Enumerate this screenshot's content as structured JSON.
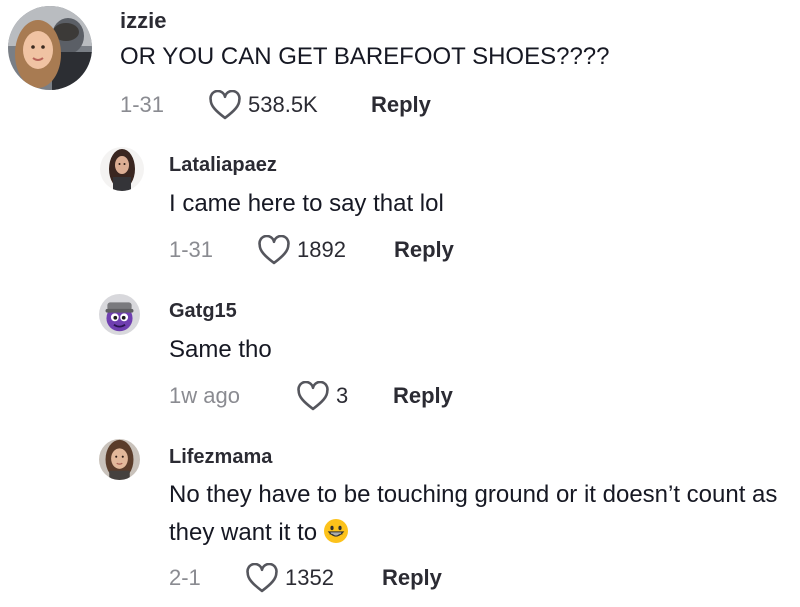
{
  "comments": [
    {
      "username": "izzie",
      "text": "OR YOU CAN GET BAREFOOT SHOES????",
      "date": "1-31",
      "likes": "538.5K",
      "reply_label": "Reply",
      "avatar_icon": "profile-photo-avatar"
    },
    {
      "username": "Lataliapaez",
      "text": "I came here to say that lol",
      "date": "1-31",
      "likes": "1892",
      "reply_label": "Reply",
      "avatar_icon": "profile-photo-avatar"
    },
    {
      "username": "Gatg15",
      "text": "Same tho",
      "date": "1w ago",
      "likes": "3",
      "reply_label": "Reply",
      "avatar_icon": "purple-monster-avatar"
    },
    {
      "username": "Lifezmama",
      "text": "No they have to be touching ground or it doesn’t count as they want it to",
      "emoji": "grinning-face-emoji",
      "date": "2-1",
      "likes": "1352",
      "reply_label": "Reply",
      "avatar_icon": "profile-photo-avatar"
    }
  ],
  "colors": {
    "text": "#161823",
    "secondary": "#8a8b91",
    "background": "#ffffff"
  }
}
